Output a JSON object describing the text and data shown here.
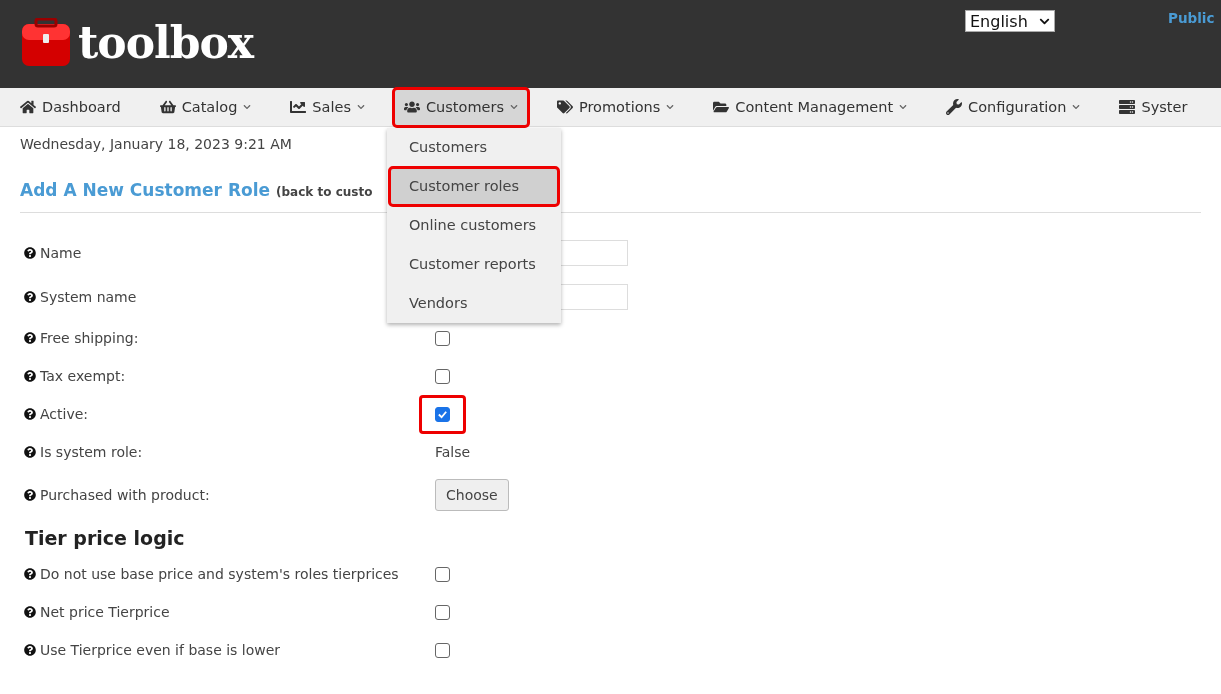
{
  "header": {
    "logo": "toolbox",
    "language": {
      "value": "English"
    },
    "link": "Public"
  },
  "nav": [
    {
      "label": "Dashboard",
      "dropdown": false,
      "selected": false,
      "highlighted": false
    },
    {
      "label": "Catalog",
      "dropdown": true,
      "selected": false,
      "highlighted": false
    },
    {
      "label": "Sales",
      "dropdown": true,
      "selected": false,
      "highlighted": false
    },
    {
      "label": "Customers",
      "dropdown": true,
      "selected": true,
      "highlighted": true,
      "menu": [
        {
          "label": "Customers",
          "selected": false,
          "highlighted": false
        },
        {
          "label": "Customer roles",
          "selected": true,
          "highlighted": true
        },
        {
          "label": "Online customers",
          "selected": false,
          "highlighted": false
        },
        {
          "label": "Customer reports",
          "selected": false,
          "highlighted": false
        },
        {
          "label": "Vendors",
          "selected": false,
          "highlighted": false
        }
      ]
    },
    {
      "label": "Promotions",
      "dropdown": true,
      "selected": false,
      "highlighted": false
    },
    {
      "label": "Content Management",
      "dropdown": true,
      "selected": false,
      "highlighted": false
    },
    {
      "label": "Configuration",
      "dropdown": true,
      "selected": false,
      "highlighted": false
    },
    {
      "label": "Syster",
      "dropdown": false,
      "selected": false,
      "highlighted": false
    }
  ],
  "date": "Wednesday, January 18, 2023 9:21 AM",
  "title": "Add A New Customer Role",
  "back_link": "(back to custo",
  "fields": [
    {
      "label": "Name",
      "kind": "text"
    },
    {
      "label": "System name",
      "kind": "text"
    },
    {
      "label": "Free shipping:",
      "kind": "checkbox",
      "checked": false,
      "highlighted": false
    },
    {
      "label": "Tax exempt:",
      "kind": "checkbox",
      "checked": false,
      "highlighted": false
    },
    {
      "label": "Active:",
      "kind": "checkbox",
      "checked": true,
      "highlighted": true
    },
    {
      "label": "Is system role:",
      "kind": "value",
      "value": "False"
    },
    {
      "label": "Purchased with product:",
      "kind": "button",
      "button": "Choose"
    }
  ],
  "tier_heading": "Tier price logic",
  "tier_fields": [
    {
      "label": "Do not use base price and system's roles tierprices",
      "kind": "checkbox",
      "checked": false,
      "highlighted": false
    },
    {
      "label": "Net price Tierprice",
      "kind": "checkbox",
      "checked": false,
      "highlighted": false
    },
    {
      "label": "Use Tierprice even if base is lower",
      "kind": "checkbox",
      "checked": false,
      "highlighted": false
    }
  ]
}
